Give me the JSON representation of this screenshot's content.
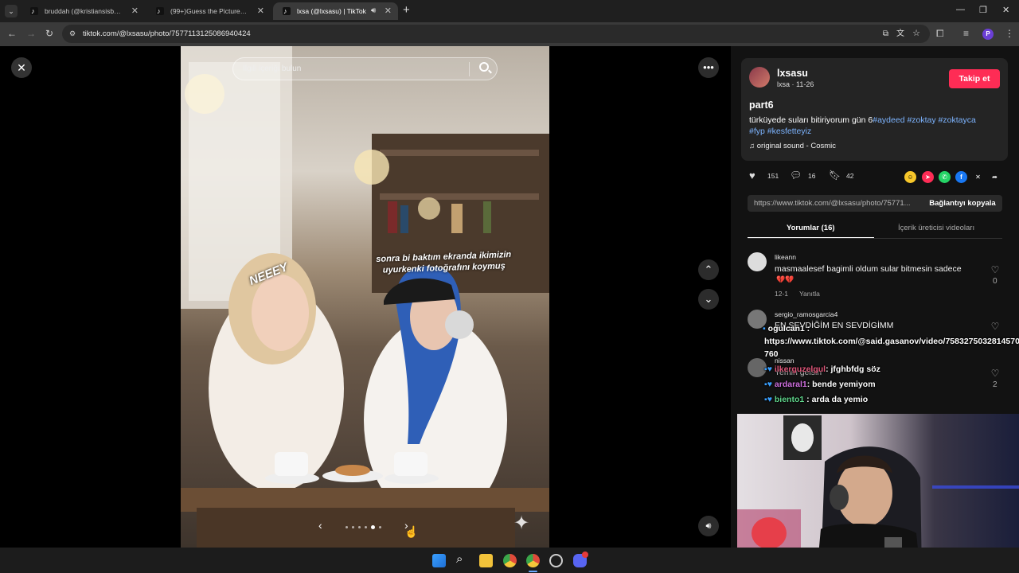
{
  "browser": {
    "tabs": [
      {
        "title": "bruddah (@kristiansisbored) | TikTok"
      },
      {
        "title": "(99+)Guess the Picture Challenge"
      },
      {
        "title": "lxsa (@lxsasu) | TikTok"
      }
    ],
    "new_tab_label": "+",
    "url": "tiktok.com/@lxsasu/photo/7577113125086940424",
    "profile_initial": "P"
  },
  "viewer": {
    "search_placeholder": "İlgili içeriği bulun",
    "photo_caption": "sonra bi baktım ekranda ikimizin uyurkenki fotoğrafını koymuş",
    "photo_sticker": "NEEEY",
    "carousel_total": 6,
    "carousel_index": 5
  },
  "post": {
    "username": "lxsasu",
    "display_meta": "lxsa · 11-26",
    "follow_label": "Takip et",
    "title": "part6",
    "description_text": "türküyede suları bitiriyorum gün 6",
    "hashtags_line1": "#aydeed #zoktay #zoktayca",
    "hashtags_line2": "#fyp #kesfetteyiz",
    "sound": "original sound - Cosmic",
    "likes": "151",
    "comments": "16",
    "saves": "42",
    "link": "https://www.tiktok.com/@lxsasu/photo/75771...",
    "copy_link_label": "Bağlantıyı kopyala"
  },
  "tabs": {
    "comments": "Yorumlar (16)",
    "creator_videos": "İçerik üreticisi videoları"
  },
  "comments": [
    {
      "user": "likeann",
      "text": "masmaalesef bagimli oldum sular bitmesin sadece",
      "emoji": "💔💔",
      "date": "12-1",
      "reply": "Yanıtla",
      "likes": "0"
    },
    {
      "user": "sergio_ramosgarcia4",
      "text": "EN SEVDİĞİM EN SEVDİGİMM",
      "likes": ""
    },
    {
      "user": "nissan",
      "text": "Yemin gelsin",
      "likes": "2"
    }
  ],
  "chat_overlay": {
    "line1_user": "ogulcan1",
    "line1_text": ":",
    "link_line1": "https://www.tiktok.com/@said.gasanov/video/7583275032814570",
    "link_line2": "760",
    "line2_user": "ilkerguzelgul",
    "line2_text": ": jfghbfdg söz",
    "line3_user": "ardaral1",
    "line3_text": ": bende yemiyom",
    "line4_user": "biento1",
    "line4_text": ": arda da yemio"
  },
  "colors": {
    "accent": "#fe2c55",
    "hashtag": "#7db4ff",
    "panel_bg": "#121212",
    "card_bg": "#242424"
  }
}
